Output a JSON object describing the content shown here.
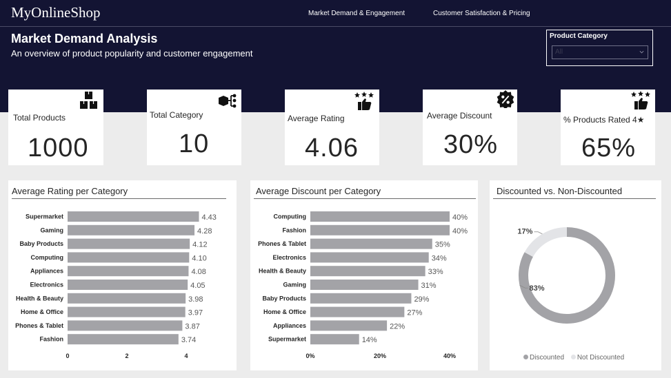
{
  "header": {
    "logo": "MyOnlineShop",
    "nav": [
      "Market Demand & Engagement",
      "Customer Satisfaction & Pricing"
    ],
    "title": "Market Demand Analysis",
    "subtitle": "An overview of product popularity and customer engagement"
  },
  "filter": {
    "label": "Product Category",
    "value": "All",
    "icon": "chevron-down-icon"
  },
  "kpis": [
    {
      "label": "Total Products",
      "value": "1000",
      "icon": "boxes-icon"
    },
    {
      "label": "Total Category",
      "value": "10",
      "icon": "category-tree-icon"
    },
    {
      "label": "Average Rating",
      "value": "4.06",
      "icon": "thumbs-up-stars-icon"
    },
    {
      "label": "Average Discount",
      "value": "30%",
      "icon": "discount-badge-icon"
    },
    {
      "label": "% Products Rated 4★",
      "value": "65%",
      "icon": "thumbs-up-stars-icon"
    }
  ],
  "colors": {
    "header_bg": "#131433",
    "bar": "#a3a3a7",
    "donut_main": "#a3a3a7",
    "donut_light": "#e3e4e7"
  },
  "panels": {
    "rating_title": "Average Rating per Category",
    "discount_title": "Average Discount per Category",
    "donut_title": "Discounted vs. Non-Discounted"
  },
  "chart_data": [
    {
      "type": "bar",
      "orientation": "horizontal",
      "title": "Average Rating per Category",
      "categories": [
        "Supermarket",
        "Gaming",
        "Baby Products",
        "Computing",
        "Appliances",
        "Electronics",
        "Health & Beauty",
        "Home & Office",
        "Phones & Tablet",
        "Fashion"
      ],
      "values": [
        4.43,
        4.28,
        4.12,
        4.1,
        4.08,
        4.05,
        3.98,
        3.97,
        3.87,
        3.74
      ],
      "value_labels": [
        "4.43",
        "4.28",
        "4.12",
        "4.10",
        "4.08",
        "4.05",
        "3.98",
        "3.97",
        "3.87",
        "3.74"
      ],
      "xticks": [
        "0",
        "2",
        "4"
      ],
      "xtick_values": [
        0,
        2,
        4
      ],
      "xlim": [
        0,
        4.75
      ],
      "grid": false
    },
    {
      "type": "bar",
      "orientation": "horizontal",
      "title": "Average Discount per Category",
      "categories": [
        "Computing",
        "Fashion",
        "Phones & Tablet",
        "Electronics",
        "Health & Beauty",
        "Gaming",
        "Baby Products",
        "Home & Office",
        "Appliances",
        "Supermarket"
      ],
      "values": [
        40,
        40,
        35,
        34,
        33,
        31,
        29,
        27,
        22,
        14
      ],
      "value_labels": [
        "40%",
        "40%",
        "35%",
        "34%",
        "33%",
        "31%",
        "29%",
        "27%",
        "22%",
        "14%"
      ],
      "xticks": [
        "0%",
        "20%",
        "40%"
      ],
      "xtick_values": [
        0,
        20,
        40
      ],
      "xlim": [
        0,
        40
      ],
      "grid": false
    },
    {
      "type": "pie",
      "subtype": "donut",
      "title": "Discounted vs. Non-Discounted",
      "categories": [
        "Discounted",
        "Not Discounted"
      ],
      "values": [
        83,
        17
      ],
      "value_labels": [
        "83%",
        "17%"
      ],
      "legend": "bottom"
    }
  ]
}
